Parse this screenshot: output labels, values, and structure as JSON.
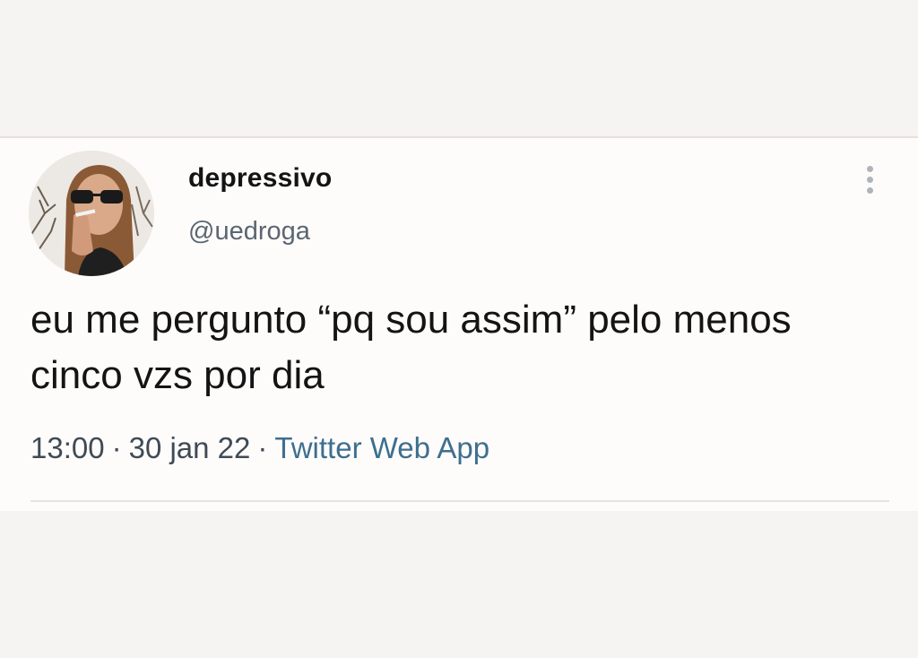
{
  "tweet": {
    "display_name": "depressivo",
    "handle": "@uedroga",
    "text": "eu me pergunto “pq sou assim” pelo menos cinco vzs por dia",
    "time": "13:00",
    "separator": "·",
    "date": "30 jan 22",
    "source": "Twitter Web App"
  },
  "icons": {
    "more": "more-vertical-icon",
    "avatar": "profile-photo"
  },
  "colors": {
    "background": "#f6f4f2",
    "card": "#fdfcfb",
    "text": "#141414",
    "muted": "#5b6670",
    "link": "#3d6f8f"
  }
}
